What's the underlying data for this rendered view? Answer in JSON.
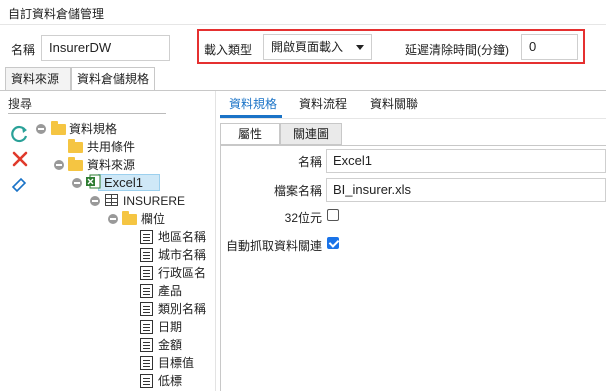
{
  "window": {
    "title": "自訂資料倉儲管理"
  },
  "header": {
    "name_label": "名稱",
    "name_value": "InsurerDW",
    "load_type_label": "載入類型",
    "load_type_value": "開啟頁面載入",
    "cleanup_label": "延遲清除時間(分鐘)",
    "cleanup_value": "0"
  },
  "tabs": [
    {
      "label": "資料來源",
      "active": false
    },
    {
      "label": "資料倉儲規格",
      "active": true
    }
  ],
  "tree": {
    "search_placeholder": "搜尋",
    "nodes": {
      "spec": "資料規格",
      "common": "共用條件",
      "source": "資料來源",
      "excel": "Excel1",
      "insurere": "INSURERE",
      "fields": "欄位"
    },
    "field_items": [
      "地區名稱",
      "城市名稱",
      "行政區名",
      "產品",
      "類別名稱",
      "日期",
      "金額",
      "目標值",
      "低標"
    ]
  },
  "right_tabs": [
    "資料規格",
    "資料流程",
    "資料關聯"
  ],
  "sub_tabs": [
    "屬性",
    "關連圖"
  ],
  "properties": {
    "name_label": "名稱",
    "name_value": "Excel1",
    "file_label": "檔案名稱",
    "file_value": "BI_insurer.xls",
    "bit32_label": "32位元",
    "bit32_checked": false,
    "auto_label": "自動抓取資料關連",
    "auto_checked": true
  },
  "colors": {
    "accent": "#1a73c7",
    "highlight_border": "#e53030",
    "selection": "#cfe8f7"
  }
}
